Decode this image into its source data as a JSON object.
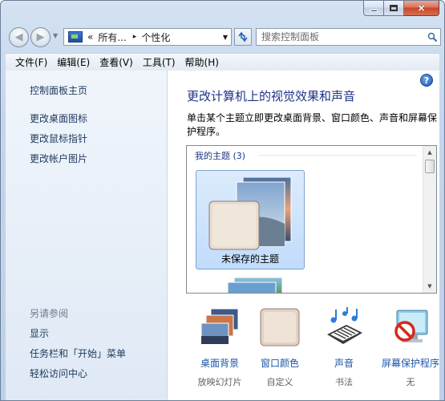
{
  "window": {
    "caption_close": "×"
  },
  "nav": {
    "address_segments": [
      "«",
      "所有...",
      "▸",
      "个性化"
    ],
    "search_placeholder": "搜索控制面板"
  },
  "menu": [
    "文件(F)",
    "编辑(E)",
    "查看(V)",
    "工具(T)",
    "帮助(H)"
  ],
  "sidebar": {
    "home": "控制面板主页",
    "links": [
      "更改桌面图标",
      "更改鼠标指针",
      "更改帐户图片"
    ],
    "see_also_title": "另请参阅",
    "see_also": [
      "显示",
      "任务栏和「开始」菜单",
      "轻松访问中心"
    ]
  },
  "main": {
    "help": "?",
    "title": "更改计算机上的视觉效果和声音",
    "description": "单击某个主题立即更改桌面背景、窗口颜色、声音和屏幕保护程序。",
    "theme_group": "我的主题 (3)",
    "theme_selected": "未保存的主题",
    "options": [
      {
        "label": "桌面背景",
        "sub": "放映幻灯片",
        "icon": "desktop-background-icon"
      },
      {
        "label": "窗口颜色",
        "sub": "自定义",
        "icon": "window-color-icon"
      },
      {
        "label": "声音",
        "sub": "书法",
        "icon": "sounds-icon"
      },
      {
        "label": "屏幕保护程序",
        "sub": "无",
        "icon": "screensaver-icon"
      }
    ]
  },
  "colors": {
    "title_blue": "#1e3287",
    "link_blue": "#1e56a8",
    "sidebar_link": "#1e395b"
  }
}
